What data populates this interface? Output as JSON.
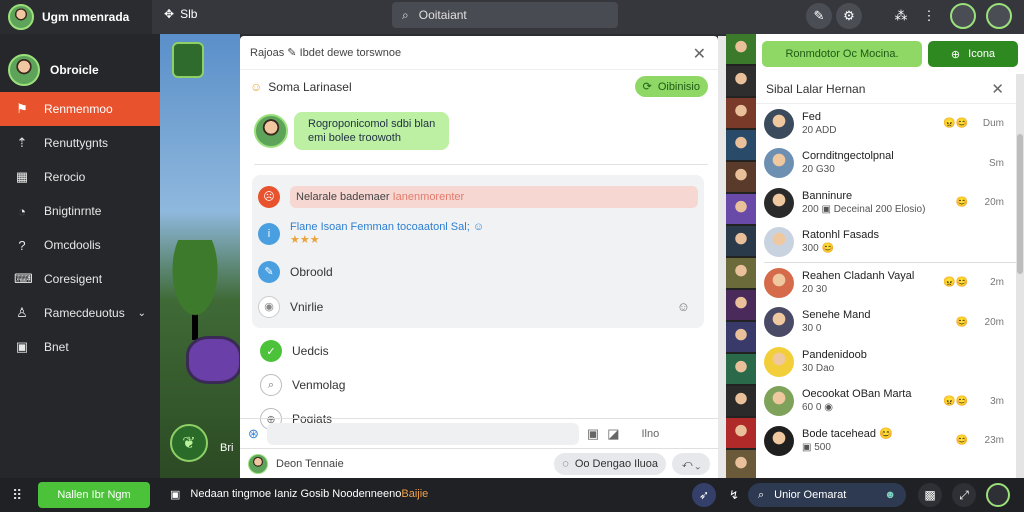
{
  "topbar": {
    "app_title": "Ugm nmenrada",
    "game_label": "Slb",
    "search_placeholder": "Ooitaiant"
  },
  "sidebar": {
    "user_name": "Obroicle",
    "items": [
      {
        "label": "Renmenmoo",
        "icon": "inventory-icon",
        "glyph": "⚑",
        "active": true
      },
      {
        "label": "Renuttygnts",
        "icon": "arrow-up-icon",
        "glyph": "⇡",
        "active": false
      },
      {
        "label": "Rerocio",
        "icon": "store-icon",
        "glyph": "▦",
        "active": false
      },
      {
        "label": "Bnigtinrnte",
        "icon": "compass-icon",
        "glyph": "◔",
        "active": false
      },
      {
        "label": "Omcdoolis",
        "icon": "question-icon",
        "glyph": "?",
        "active": false
      },
      {
        "label": "Coresigent",
        "icon": "keyboard-icon",
        "glyph": "⌨",
        "active": false
      },
      {
        "label": "Ramecdeuotus",
        "icon": "group-icon",
        "glyph": "♙",
        "active": false,
        "chevron": true
      },
      {
        "label": "Bnet",
        "icon": "screen-icon",
        "glyph": "▣",
        "active": false
      }
    ]
  },
  "game": {
    "bottom_label": "Bri"
  },
  "modal": {
    "title": "Rajoas ✎ Ibdet dewe torswnoe",
    "subheader": "Soma Larinasel",
    "status_button": "Oibinisio",
    "bubble_line1": "Rogroponicomol sdbi blan",
    "bubble_line2": "emi bolee troowoth",
    "warning_text": "Nelarale bademaer",
    "warning_highlight": "Ianenmorenter",
    "info_text": "Flane Isoan Femman tocoaatonl Sal;",
    "info_stars": "★★★",
    "options": [
      {
        "label": "Obroold",
        "icon": "pencil-icon"
      },
      {
        "label": "Vnirlie",
        "icon": "eye-icon"
      }
    ],
    "list": [
      {
        "label": "Uedcis",
        "icon": "check-icon"
      },
      {
        "label": "Venmolag",
        "icon": "search-icon"
      },
      {
        "label": "Pogiats",
        "icon": "zoom-icon"
      }
    ],
    "composer_send": "Ilno",
    "footer_text": "Deon Tennaie",
    "footer_pill": "Oo Dengao Iluoa"
  },
  "right": {
    "btn_primary": "Ronmdotor Oc Mocina.",
    "btn_secondary": "Icona",
    "friends_title": "Sibal Lalar Hernan",
    "friends": [
      {
        "name": "Fed",
        "sub": "20 ADD",
        "emoji": "😠😊",
        "time": "Dum",
        "av": "#3b4a5c"
      },
      {
        "name": "Cornditngectolpnal",
        "sub": "20 G30",
        "emoji": "",
        "time": "Sm",
        "av": "#6c8fb2"
      },
      {
        "name": "Banninure",
        "sub": "200 ▣ Deceinal 200 Elosio)",
        "emoji": "😊",
        "time": "20m",
        "av": "#2a2a2a"
      },
      {
        "name": "Ratonhl Fasads",
        "sub": "300 😊",
        "emoji": "",
        "time": "",
        "av": "#c9d3df"
      },
      {
        "name": "Reahen Cladanh Vayal",
        "sub": "20 30",
        "emoji": "😠😊",
        "time": "2m",
        "av": "#d66b4b"
      },
      {
        "name": "Senehe Mand",
        "sub": "30 0",
        "emoji": "😊",
        "time": "20m",
        "av": "#4a4a66"
      },
      {
        "name": "Pandenidoob",
        "sub": "30 Dao",
        "emoji": "",
        "time": "",
        "av": "#f2cf3a"
      },
      {
        "name": "Oecookat OBan Marta",
        "sub": "60 0 ◉",
        "emoji": "😠😊",
        "time": "3m",
        "av": "#7fa25a"
      },
      {
        "name": "Bode tacehead 😊",
        "sub": "▣ 500",
        "emoji": "😊",
        "time": "23m",
        "av": "#1f1f1f"
      }
    ]
  },
  "bottombar": {
    "primary_button": "Nallen Ibr Ngm",
    "news_text": "Nedaan tingmoe Ianiz Gosib Noodenneeno",
    "news_highlight": "Baijie",
    "pill_text": "Unior Oemarat"
  },
  "colors": {
    "accent": "#e8522d",
    "green": "#8fd866",
    "dark_green": "#2e8a20"
  }
}
